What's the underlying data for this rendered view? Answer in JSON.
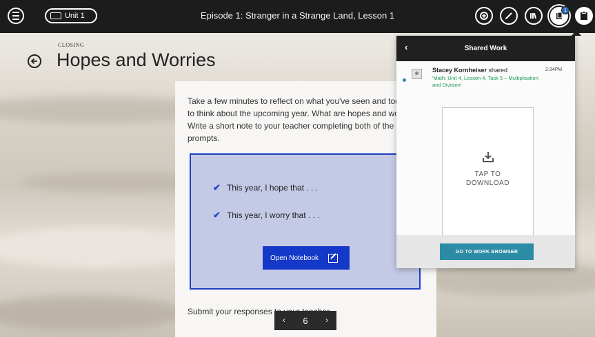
{
  "topbar": {
    "unit_label": "Unit 1",
    "title": "Episode 1: Stranger in a Strange Land, Lesson 1",
    "shared_badge": "1"
  },
  "lesson": {
    "section": "CLOSING",
    "heading": "Hopes and Worries",
    "instructions": "Take a few minutes to reflect on what you've seen and today and to think about the upcoming year. What are hopes and worries? Write a short note to your teacher completing both of the following prompts.",
    "prompts": [
      "This year, I hope that . . .",
      "This year, I worry that . . ."
    ],
    "notebook_button": "Open Notebook",
    "submit_text": "Submit your responses to your teacher."
  },
  "pager": {
    "page": "6"
  },
  "shared_panel": {
    "title": "Shared Work",
    "sender": "Stacey Kornheiser",
    "action": " shared",
    "time": "2:34PM",
    "item": "'Math: Unit 4, Lesson 4, Task 5 – Multiplication and Division'",
    "download_line1": "TAP TO",
    "download_line2": "DOWNLOAD",
    "button": "GO TO WORK BROWSER"
  },
  "colors": {
    "topbar": "#1c1c1c",
    "accent_blue": "#1438c8",
    "prompt_bg": "#c4cae6",
    "teal": "#2d8ca5",
    "link_green": "#1c9a5a"
  }
}
